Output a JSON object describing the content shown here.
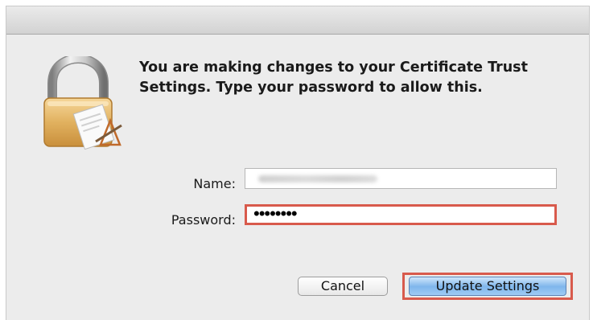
{
  "dialog": {
    "message": "You are making changes to your Certificate Trust Settings. Type your password to allow this.",
    "icon": "lock-icon"
  },
  "fields": {
    "name_label": "Name:",
    "password_label": "Password:",
    "password_value": "••••••••"
  },
  "buttons": {
    "cancel_label": "Cancel",
    "update_label": "Update Settings"
  },
  "colors": {
    "highlight": "#d85a4c",
    "default_button": "#7fb6ec"
  }
}
